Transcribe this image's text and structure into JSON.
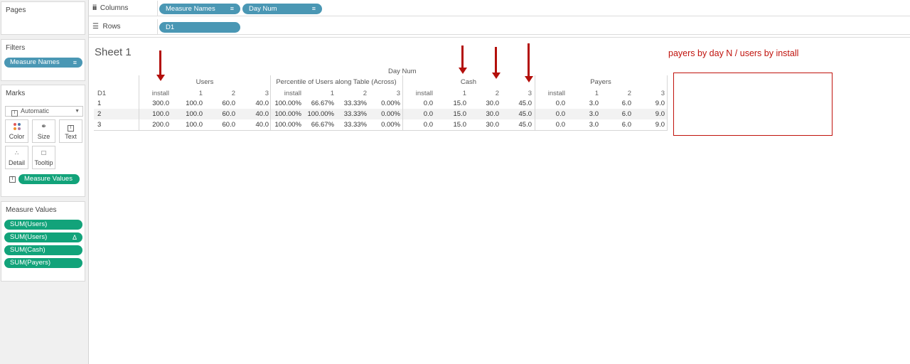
{
  "pages_card": {
    "title": "Pages"
  },
  "filters_card": {
    "title": "Filters",
    "pills": [
      {
        "label": "Measure Names",
        "sort_icon": "sort-icon"
      }
    ]
  },
  "marks_card": {
    "title": "Marks",
    "mark_type": "Automatic",
    "buttons": {
      "color": "Color",
      "size": "Size",
      "text": "Text",
      "detail": "Detail",
      "tooltip": "Tooltip"
    },
    "field_pill": "Measure Values"
  },
  "measure_values_card": {
    "title": "Measure Values",
    "items": [
      "SUM(Users)",
      "SUM(Users)",
      "SUM(Cash)",
      "SUM(Payers)"
    ],
    "delta_symbol": "Δ"
  },
  "columns_shelf": {
    "label": "Columns",
    "pills": [
      "Measure Names",
      "Day Num"
    ]
  },
  "rows_shelf": {
    "label": "Rows",
    "pills": [
      "D1"
    ]
  },
  "sheet": {
    "title": "Sheet 1",
    "annotation": "payers by day N / users by install",
    "colors": {
      "accent_blue": "#4a97b4",
      "accent_green": "#12a37a",
      "annotation_red": "#c0120c"
    }
  },
  "table": {
    "super_header": "Day Num",
    "row_header": "D1",
    "groups": [
      "Users",
      "Percentile of Users along Table (Across)",
      "Cash",
      "Payers"
    ],
    "sub_headers": [
      "install",
      "1",
      "2",
      "3"
    ],
    "rows": [
      {
        "d1": "1",
        "users": [
          "300.0",
          "100.0",
          "60.0",
          "40.0"
        ],
        "pct": [
          "100.00%",
          "66.67%",
          "33.33%",
          "0.00%"
        ],
        "cash": [
          "0.0",
          "15.0",
          "30.0",
          "45.0"
        ],
        "payers": [
          "0.0",
          "3.0",
          "6.0",
          "9.0"
        ]
      },
      {
        "d1": "2",
        "users": [
          "100.0",
          "100.0",
          "60.0",
          "40.0"
        ],
        "pct": [
          "100.00%",
          "100.00%",
          "33.33%",
          "0.00%"
        ],
        "cash": [
          "0.0",
          "15.0",
          "30.0",
          "45.0"
        ],
        "payers": [
          "0.0",
          "3.0",
          "6.0",
          "9.0"
        ]
      },
      {
        "d1": "3",
        "users": [
          "200.0",
          "100.0",
          "60.0",
          "40.0"
        ],
        "pct": [
          "100.00%",
          "66.67%",
          "33.33%",
          "0.00%"
        ],
        "cash": [
          "0.0",
          "15.0",
          "30.0",
          "45.0"
        ],
        "payers": [
          "0.0",
          "3.0",
          "6.0",
          "9.0"
        ]
      }
    ]
  }
}
